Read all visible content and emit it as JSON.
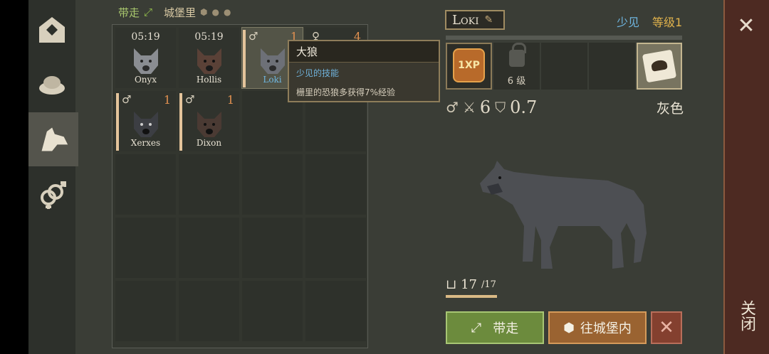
{
  "top": {
    "take_label": "带走",
    "castle_label": "城堡里"
  },
  "cells": [
    {
      "timer": "05:19",
      "name": "Onyx"
    },
    {
      "timer": "05:19",
      "name": "Hollis"
    },
    {
      "sex": "♂",
      "level": "1",
      "name": "Loki"
    },
    {
      "sex": "♀",
      "level": "4"
    },
    {
      "sex": "♂",
      "level": "1",
      "name": "Xerxes"
    },
    {
      "sex": "♂",
      "level": "1",
      "name": "Dixon"
    }
  ],
  "tooltip": {
    "title": "大狼",
    "rarity": "少见的技能",
    "desc": "栅里的恐狼多获得7%经验"
  },
  "selected": {
    "name": "Loki",
    "rarity": "少见",
    "level": "等级1",
    "skill_xp": "1XP",
    "locked_label": "6 级",
    "attack": "6",
    "defense": "0.7",
    "color_name": "灰色",
    "food": "17",
    "food_max": "/17"
  },
  "buttons": {
    "take": "带走",
    "to_castle": "往城堡内",
    "close": "关闭"
  },
  "colors": {
    "accent_green": "#6c8b3d",
    "accent_orange": "#9a6331",
    "rare_blue": "#6fb6e0"
  }
}
